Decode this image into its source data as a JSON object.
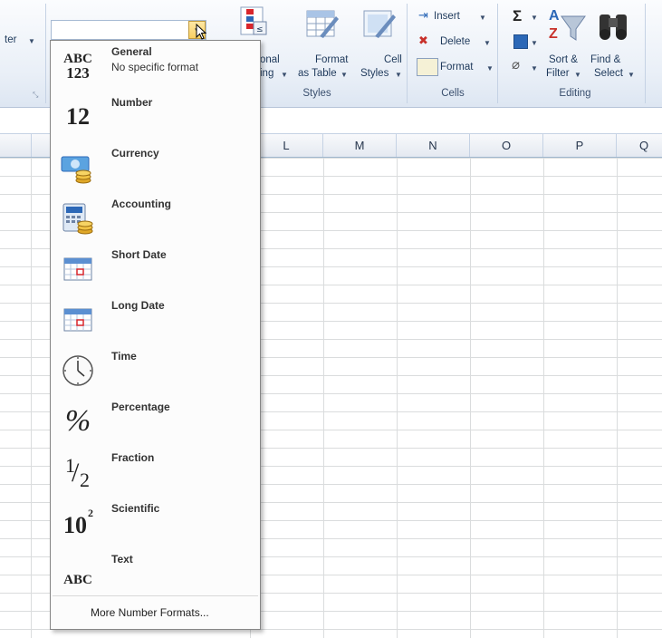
{
  "ribbon": {
    "left_partial_label": "ter",
    "styles_group": {
      "conditional_label_line1": "onal",
      "conditional_label_line2": "ing",
      "format_as_table_line1": "Format",
      "format_as_table_line2": "as Table",
      "cell_styles_line1": "Cell",
      "cell_styles_line2": "Styles",
      "group_label": "Styles"
    },
    "cells_group": {
      "insert": "Insert",
      "delete": "Delete",
      "format": "Format",
      "group_label": "Cells"
    },
    "editing_group": {
      "sort_filter_line1": "Sort &",
      "sort_filter_line2": "Filter",
      "find_select_line1": "Find &",
      "find_select_line2": "Select",
      "group_label": "Editing"
    }
  },
  "number_format_combo": {
    "value": ""
  },
  "columns": [
    "L",
    "M",
    "N",
    "O",
    "P",
    "Q"
  ],
  "menu": {
    "items": [
      {
        "title": "General",
        "subtitle": "No specific format",
        "icon": "abc-123-icon"
      },
      {
        "title": "Number",
        "subtitle": "",
        "icon": "number-12-icon"
      },
      {
        "title": "Currency",
        "subtitle": "",
        "icon": "currency-icon"
      },
      {
        "title": "Accounting",
        "subtitle": "",
        "icon": "accounting-icon"
      },
      {
        "title": "Short Date",
        "subtitle": "",
        "icon": "calendar-icon"
      },
      {
        "title": "Long Date",
        "subtitle": "",
        "icon": "calendar-icon"
      },
      {
        "title": "Time",
        "subtitle": "",
        "icon": "clock-icon"
      },
      {
        "title": "Percentage",
        "subtitle": "",
        "icon": "percent-icon"
      },
      {
        "title": "Fraction",
        "subtitle": "",
        "icon": "fraction-icon"
      },
      {
        "title": "Scientific",
        "subtitle": "",
        "icon": "scientific-icon"
      },
      {
        "title": "Text",
        "subtitle": "",
        "icon": "abc-text-icon"
      }
    ],
    "icon_labels": {
      "general_top": "ABC",
      "general_bottom": "123",
      "number": "12",
      "percent": "%",
      "fraction_num": "1",
      "fraction_den": "2",
      "sci_base": "10",
      "sci_exp": "2",
      "text": "ABC"
    },
    "more_formats": "More Number Formats..."
  }
}
